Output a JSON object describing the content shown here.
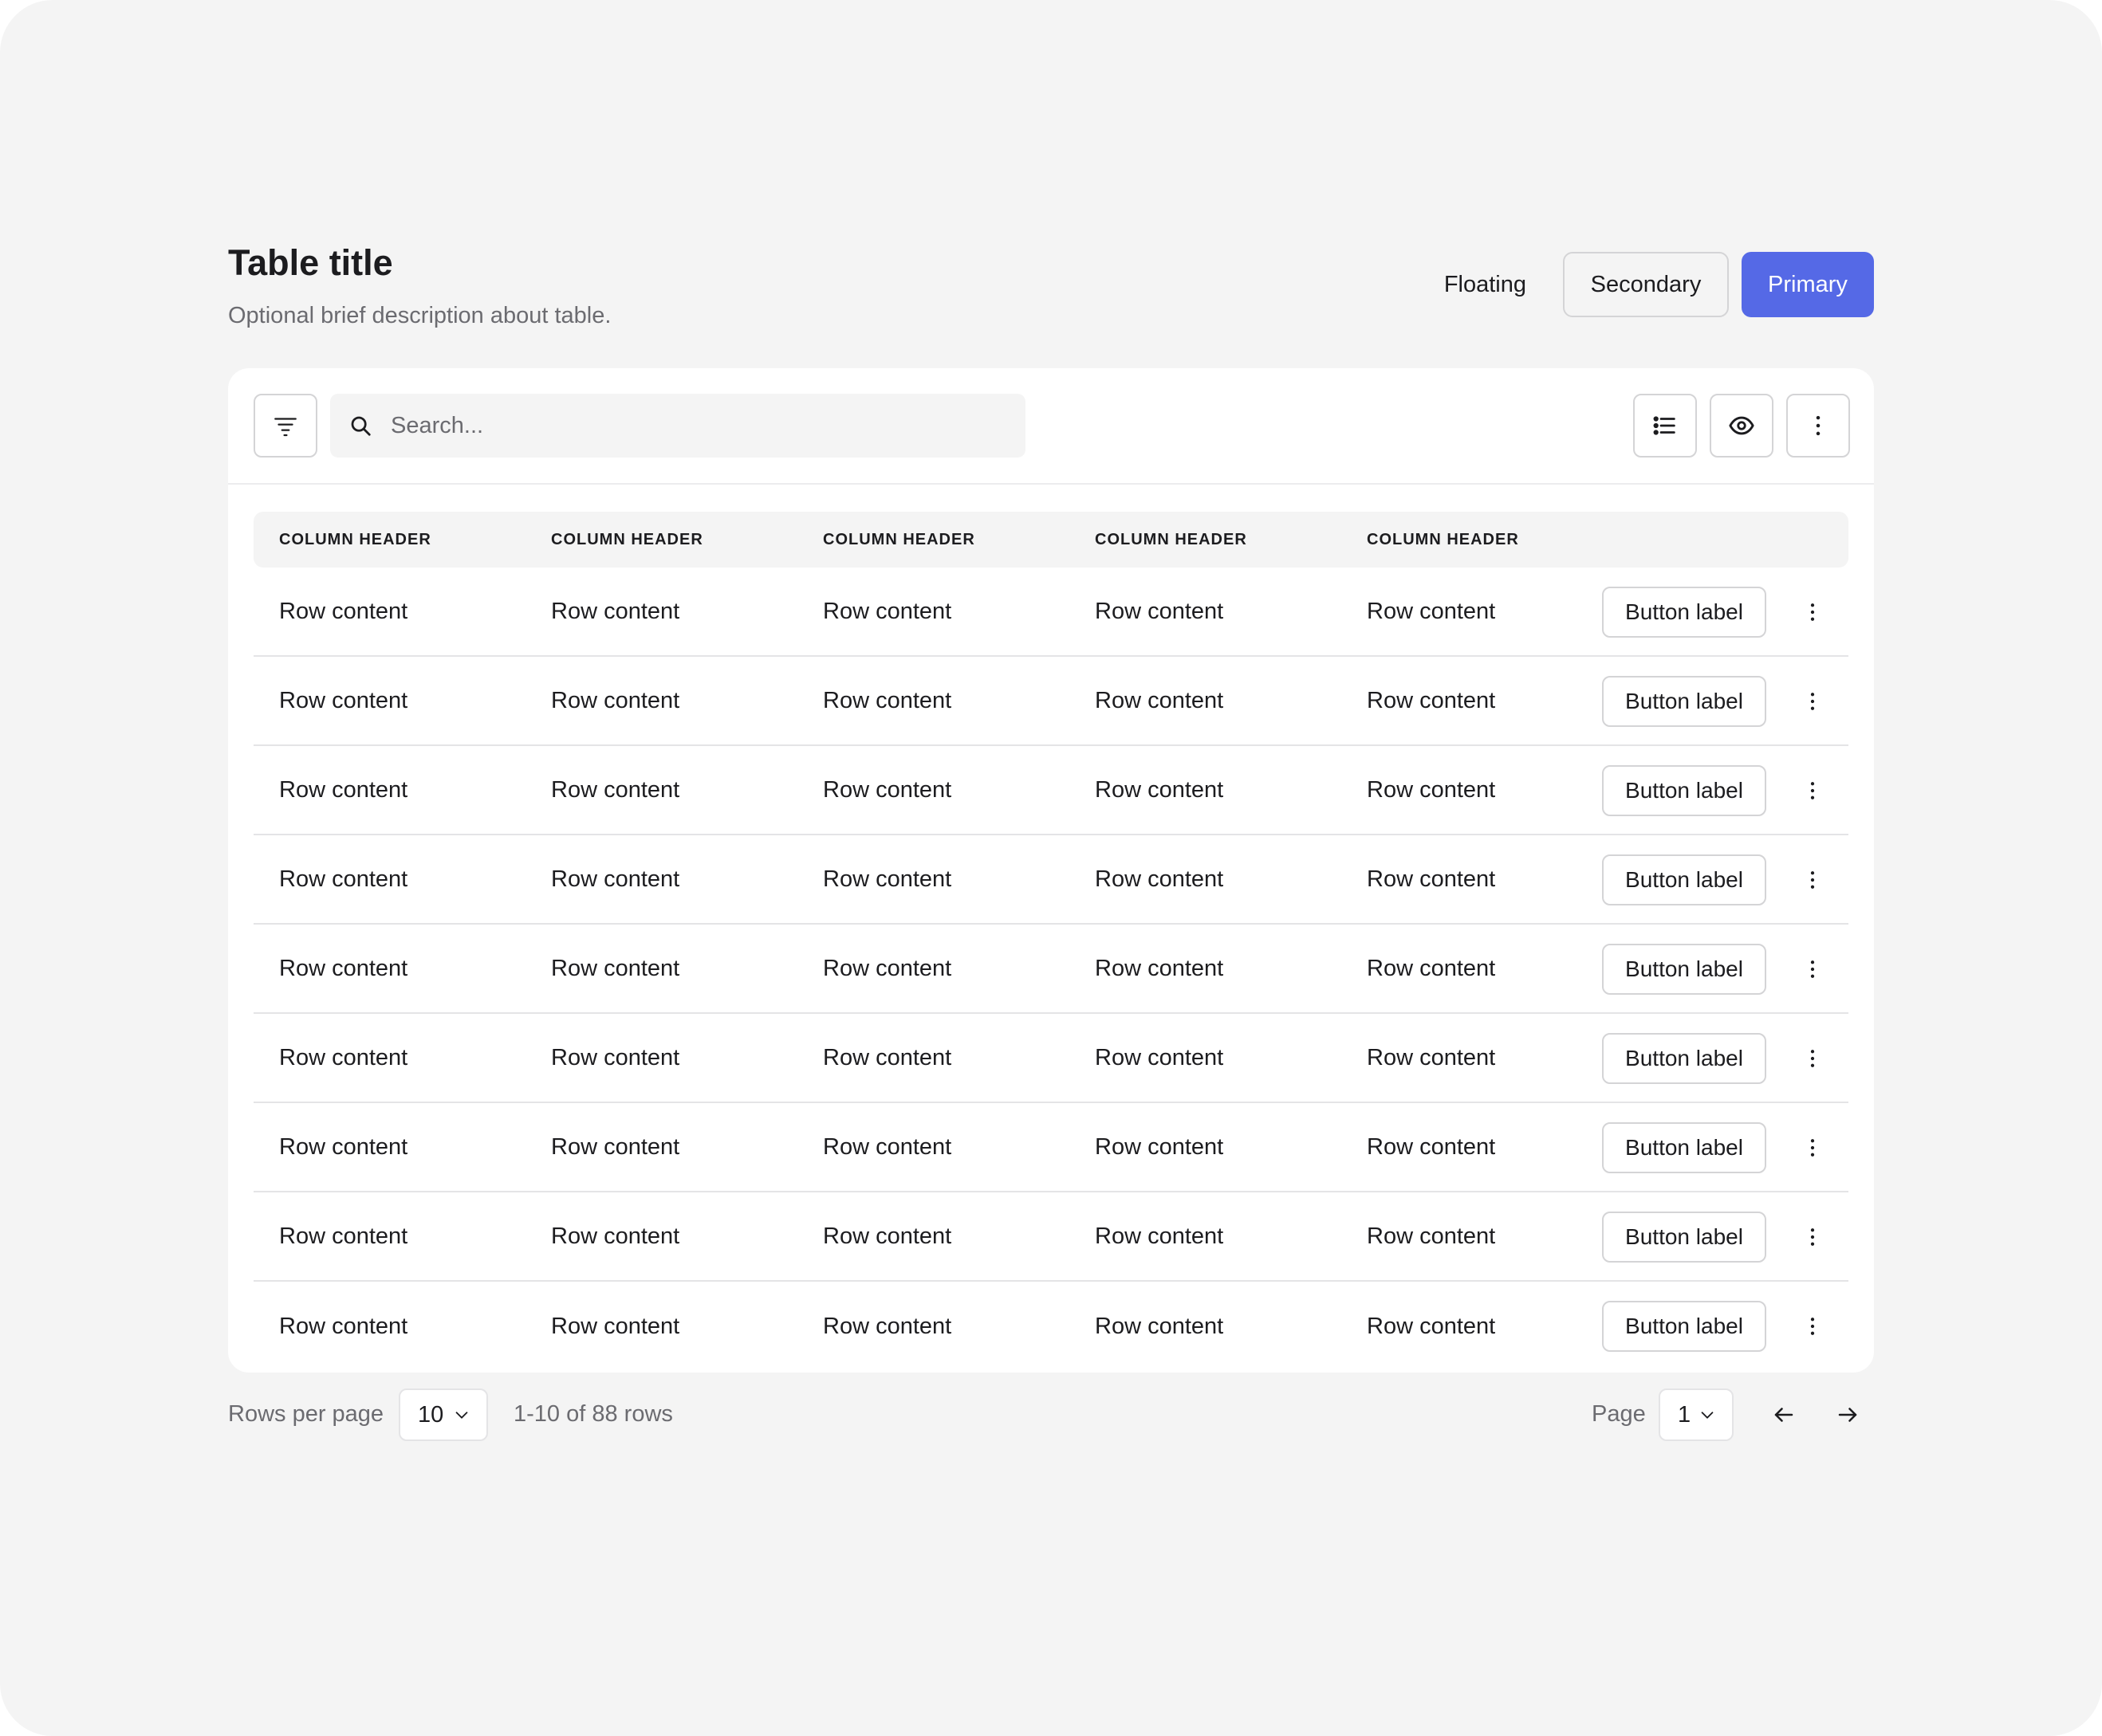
{
  "header": {
    "title": "Table title",
    "description": "Optional brief description about table.",
    "floating_label": "Floating",
    "secondary_label": "Secondary",
    "primary_label": "Primary"
  },
  "toolbar": {
    "search_placeholder": "Search..."
  },
  "table": {
    "columns": [
      "COLUMN HEADER",
      "COLUMN HEADER",
      "COLUMN HEADER",
      "COLUMN HEADER",
      "COLUMN HEADER"
    ],
    "rows": [
      {
        "cells": [
          "Row content",
          "Row content",
          "Row content",
          "Row content",
          "Row content"
        ],
        "button": "Button label"
      },
      {
        "cells": [
          "Row content",
          "Row content",
          "Row content",
          "Row content",
          "Row content"
        ],
        "button": "Button label"
      },
      {
        "cells": [
          "Row content",
          "Row content",
          "Row content",
          "Row content",
          "Row content"
        ],
        "button": "Button label"
      },
      {
        "cells": [
          "Row content",
          "Row content",
          "Row content",
          "Row content",
          "Row content"
        ],
        "button": "Button label"
      },
      {
        "cells": [
          "Row content",
          "Row content",
          "Row content",
          "Row content",
          "Row content"
        ],
        "button": "Button label"
      },
      {
        "cells": [
          "Row content",
          "Row content",
          "Row content",
          "Row content",
          "Row content"
        ],
        "button": "Button label"
      },
      {
        "cells": [
          "Row content",
          "Row content",
          "Row content",
          "Row content",
          "Row content"
        ],
        "button": "Button label"
      },
      {
        "cells": [
          "Row content",
          "Row content",
          "Row content",
          "Row content",
          "Row content"
        ],
        "button": "Button label"
      },
      {
        "cells": [
          "Row content",
          "Row content",
          "Row content",
          "Row content",
          "Row content"
        ],
        "button": "Button label"
      }
    ]
  },
  "footer": {
    "rows_per_page_label": "Rows per page",
    "rows_per_page_value": "10",
    "rows_count": "1-10 of 88 rows",
    "page_label": "Page",
    "page_value": "1"
  },
  "colors": {
    "primary": "#5569e6",
    "background": "#f4f4f4",
    "card": "#ffffff",
    "border": "#d4d4d6",
    "muted_text": "#6b6b70"
  },
  "icons": {
    "filter": "filter-icon",
    "search": "search-icon",
    "list": "list-icon",
    "eye": "eye-icon",
    "kebab": "kebab-icon",
    "chevron": "chevron-down-icon",
    "prev": "arrow-left-icon",
    "next": "arrow-right-icon"
  }
}
